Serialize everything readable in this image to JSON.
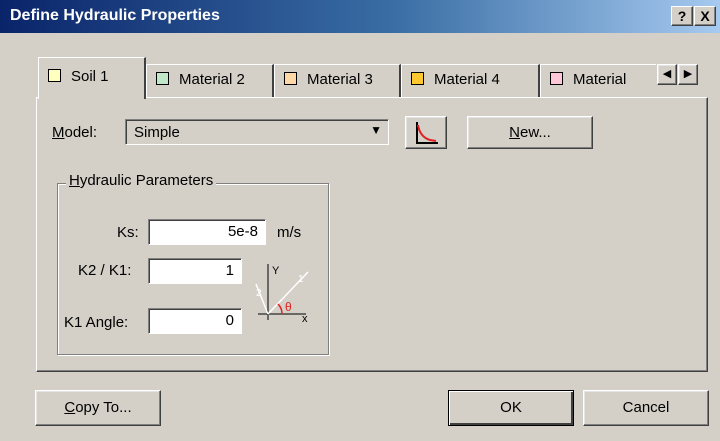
{
  "window": {
    "title": "Define Hydraulic Properties",
    "help_button": "?",
    "close_button": "X"
  },
  "tabs": [
    {
      "label": "Soil 1",
      "color": "#ffffc0",
      "active": true
    },
    {
      "label": "Material 2",
      "color": "#c0e8c8",
      "active": false
    },
    {
      "label": "Material 3",
      "color": "#ffd8a8",
      "active": false
    },
    {
      "label": "Material 4",
      "color": "#ffc830",
      "active": false
    },
    {
      "label": "Material",
      "color": "#ffc8d8",
      "active": false
    }
  ],
  "tab_scroll": {
    "left_icon": "◀",
    "right_icon": "▶"
  },
  "model": {
    "label": "Model:",
    "value": "Simple",
    "dropdown_icon": "▼",
    "new_button": "New..."
  },
  "hydraulic": {
    "group_title": "Hydraulic Parameters",
    "ks_label": "Ks:",
    "ks_value": "5e-8",
    "ks_unit": "m/s",
    "k2k1_label": "K2 / K1:",
    "k2k1_value": "1",
    "angle_label": "K1 Angle:",
    "angle_value": "0",
    "diagram": {
      "y": "Y",
      "x": "x",
      "one": "1",
      "two": "2",
      "theta": "θ"
    }
  },
  "footer": {
    "copy_to": "Copy To...",
    "ok": "OK",
    "cancel": "Cancel"
  }
}
